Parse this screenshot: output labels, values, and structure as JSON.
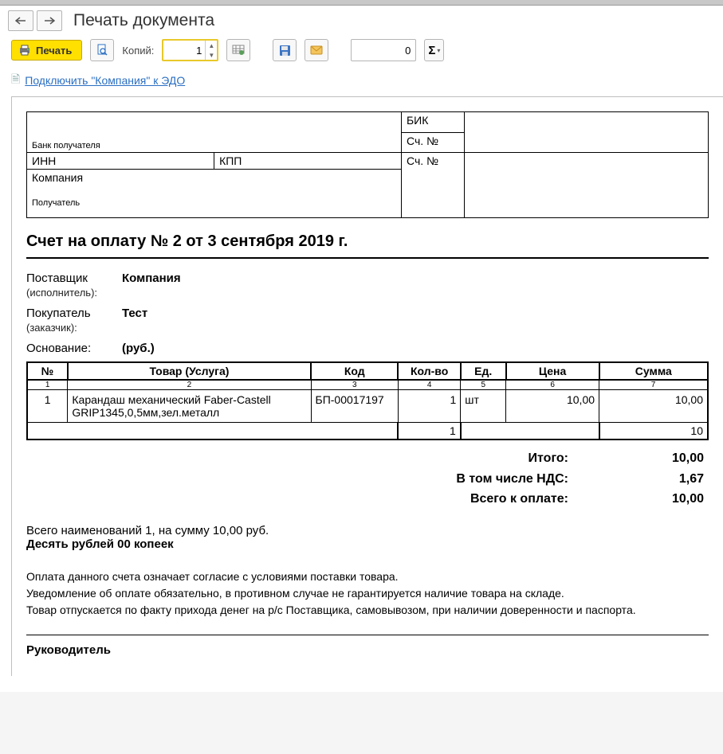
{
  "title": "Печать документа",
  "toolbar": {
    "print_label": "Печать",
    "copies_label": "Копий:",
    "copies_value": "1",
    "num_field_value": "0"
  },
  "link": "Подключить \"Компания\" к ЭДО",
  "bank": {
    "bik": "БИК",
    "acc1": "Сч. №",
    "bank_recipient": "Банк получателя",
    "inn": "ИНН",
    "kpp": "КПП",
    "acc2": "Сч. №",
    "company": "Компания",
    "recipient": "Получатель"
  },
  "doc_title": "Счет на оплату № 2 от 3 сентября 2019 г.",
  "parties": {
    "supplier_lbl": "Поставщик",
    "supplier_sub": "(исполнитель):",
    "supplier_val": "Компания",
    "buyer_lbl": "Покупатель",
    "buyer_sub": "(заказчик):",
    "buyer_val": "Тест",
    "basis_lbl": "Основание:",
    "basis_val": "(руб.)"
  },
  "table": {
    "headers": {
      "n": "№",
      "goods": "Товар (Услуга)",
      "code": "Код",
      "qty": "Кол-во",
      "unit": "Ед.",
      "price": "Цена",
      "sum": "Сумма"
    },
    "colnums": {
      "n": "1",
      "goods": "2",
      "code": "3",
      "qty": "4",
      "unit": "5",
      "price": "6",
      "sum": "7"
    },
    "rows": [
      {
        "n": "1",
        "goods": "Карандаш механический Faber-Castell GRIP1345,0,5мм,зел.металл",
        "code": "БП-00017197",
        "qty": "1",
        "unit": "шт",
        "price": "10,00",
        "sum": "10,00"
      }
    ],
    "totals_row": {
      "qty": "1",
      "sum": "10"
    }
  },
  "summary": {
    "itogo_lbl": "Итого:",
    "itogo_val": "10,00",
    "nds_lbl": "В том числе НДС:",
    "nds_val": "1,67",
    "total_lbl": "Всего к оплате:",
    "total_val": "10,00"
  },
  "footer": {
    "line1": "Всего наименований 1, на сумму 10,00 руб.",
    "line2": "Десять рублей 00 копеек",
    "fine1": "Оплата данного счета означает согласие с условиями поставки товара.",
    "fine2": "Уведомление об оплате обязательно, в противном случае не гарантируется наличие товара на складе.",
    "fine3": "Товар отпускается по факту прихода денег на р/с Поставщика, самовывозом, при наличии доверенности и паспорта.",
    "director": "Руководитель"
  }
}
